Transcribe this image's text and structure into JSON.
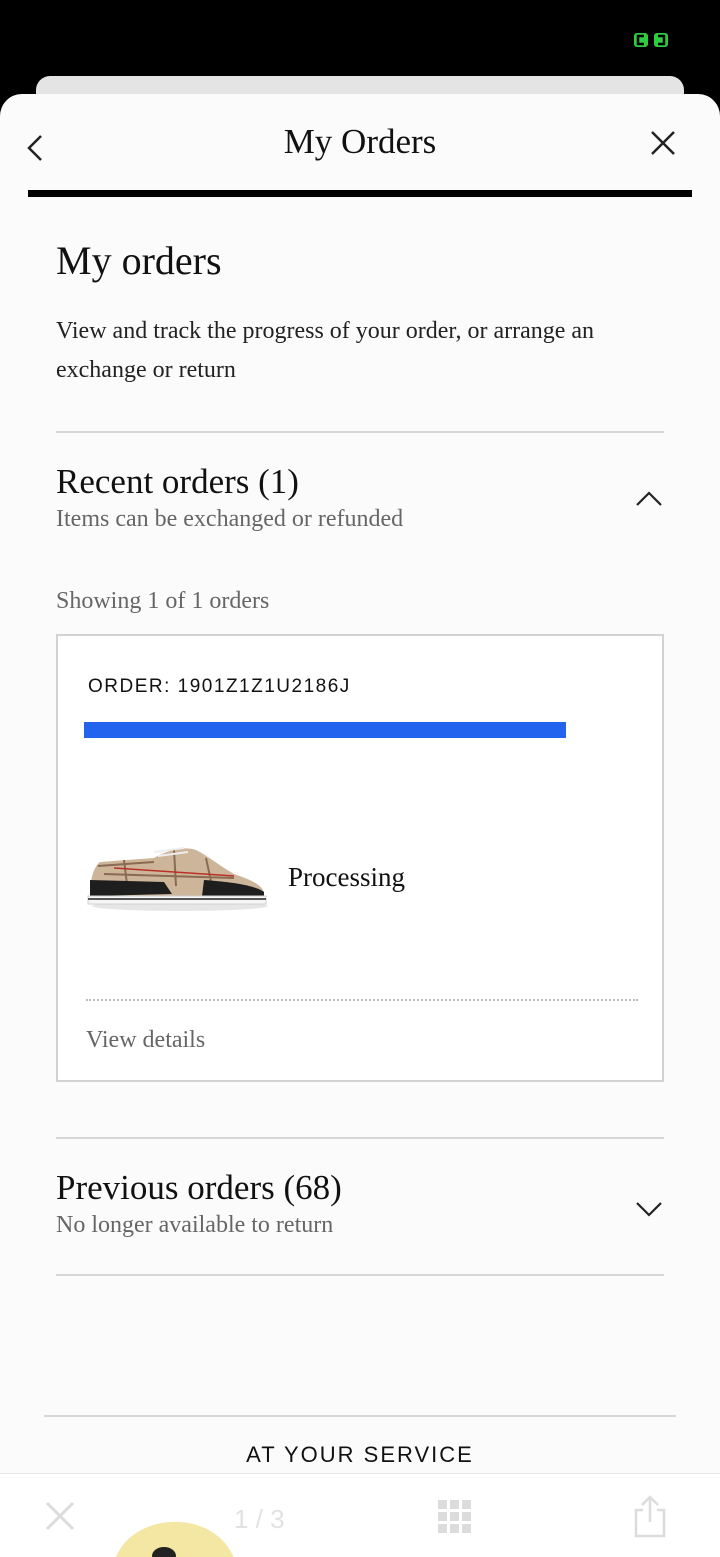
{
  "header": {
    "title": "My Orders"
  },
  "page": {
    "heading": "My orders",
    "description": "View and track the progress of your order, or arrange an exchange or return"
  },
  "recent_orders": {
    "title": "Recent orders (1)",
    "subtitle": "Items can be exchanged or refunded",
    "expanded": true,
    "showing_text": "Showing 1 of 1 orders",
    "orders": [
      {
        "order_label": "ORDER: 1901Z1Z1U2186J",
        "status": "Processing",
        "product_image": "sneaker-icon",
        "details_link": "View details"
      }
    ]
  },
  "previous_orders": {
    "title": "Previous orders (68)",
    "subtitle": "No longer available to return",
    "expanded": false
  },
  "footer": {
    "service_heading": "AT YOUR SERVICE"
  },
  "viewer_toolbar": {
    "counter": "1 / 3"
  },
  "colors": {
    "accent_redaction": "#2364ee",
    "status_icon": "#2ecc40"
  }
}
